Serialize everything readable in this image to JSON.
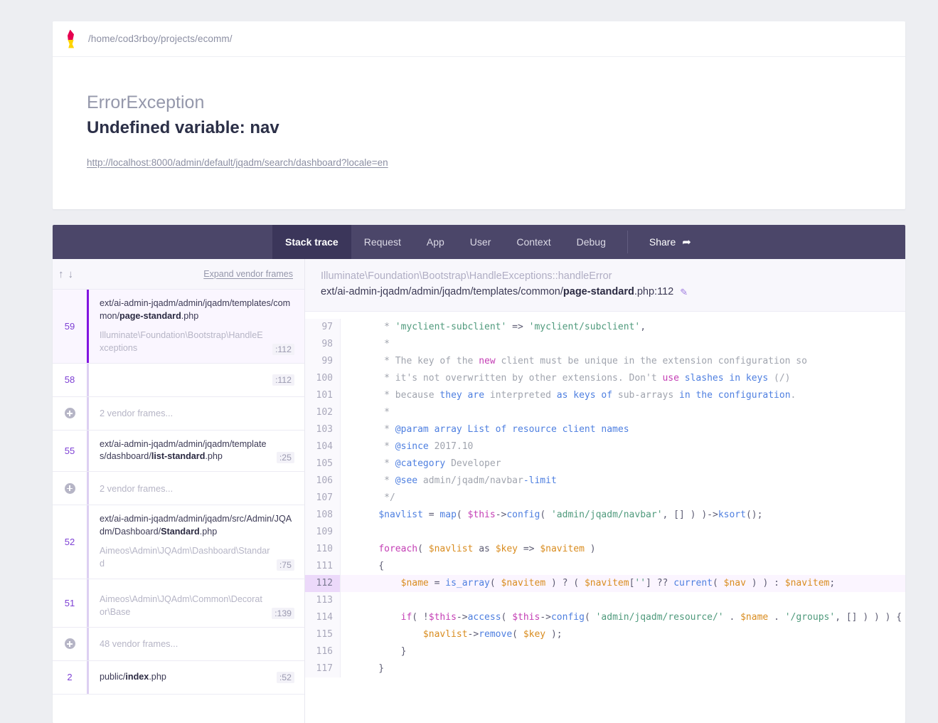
{
  "header": {
    "logo_icon": "ignition-flame-icon",
    "project_path": "/home/cod3rboy/projects/ecomm/",
    "exception_class": "ErrorException",
    "exception_message": "Undefined variable: nav",
    "request_url": "http://localhost:8000/admin/default/jqadm/search/dashboard?locale=en"
  },
  "tabs": [
    {
      "label": "Stack trace",
      "active": true
    },
    {
      "label": "Request",
      "active": false
    },
    {
      "label": "App",
      "active": false
    },
    {
      "label": "User",
      "active": false
    },
    {
      "label": "Context",
      "active": false
    },
    {
      "label": "Debug",
      "active": false
    }
  ],
  "share": {
    "label": "Share",
    "icon": "share-arrow-icon",
    "glyph": "➦"
  },
  "frames_panel": {
    "up_arrow": "↑",
    "down_arrow": "↓",
    "expand_label": "Expand vendor frames",
    "frames": [
      {
        "type": "frame",
        "number": "59",
        "path_prefix": "ext/ai-admin-jqadm/admin/jqadm/templates/common/",
        "path_file": "page-standard",
        "path_suffix": ".php",
        "class": "Illuminate\\Foundation\\Bootstrap\\HandleExceptions",
        "line": ":112",
        "active": true
      },
      {
        "type": "frame",
        "number": "58",
        "path_prefix": "",
        "path_file": "",
        "path_suffix": "",
        "class": "",
        "line": ":112",
        "active": false
      },
      {
        "type": "vendor",
        "label": "2 vendor frames...",
        "icon": "plus-circle-icon"
      },
      {
        "type": "frame",
        "number": "55",
        "path_prefix": "ext/ai-admin-jqadm/admin/jqadm/templates/dashboard/",
        "path_file": "list-standard",
        "path_suffix": ".php",
        "class": "",
        "line": ":25",
        "active": false
      },
      {
        "type": "vendor",
        "label": "2 vendor frames...",
        "icon": "plus-circle-icon"
      },
      {
        "type": "frame",
        "number": "52",
        "path_prefix": "ext/ai-admin-jqadm/admin/jqadm/src/Admin/JQAdm/Dashboard/",
        "path_file": "Standard",
        "path_suffix": ".php",
        "class": "Aimeos\\Admin\\JQAdm\\Dashboard\\Standard",
        "line": ":75",
        "active": false
      },
      {
        "type": "frame",
        "number": "51",
        "path_prefix": "",
        "path_file": "",
        "path_suffix": "",
        "class": "Aimeos\\Admin\\JQAdm\\Common\\Decorator\\Base",
        "line": ":139",
        "active": false
      },
      {
        "type": "vendor",
        "label": "48 vendor frames...",
        "icon": "plus-circle-icon"
      },
      {
        "type": "frame",
        "number": "2",
        "path_prefix": "public/",
        "path_file": "index",
        "path_suffix": ".php",
        "class": "",
        "line": ":52",
        "active": false
      }
    ]
  },
  "code_panel": {
    "class_name": "Illuminate\\Foundation\\Bootstrap\\HandleExceptions::handleError",
    "file_prefix": "ext/ai-admin-jqadm/admin/jqadm/templates/common/",
    "file_name": "page-standard",
    "file_suffix": ".php:112",
    "edit_icon": "pencil-icon",
    "edit_glyph": "✎",
    "highlighted_line": 112,
    "lines": [
      {
        "no": "97",
        "tokens": [
          {
            "t": "     * ",
            "c": "t-c"
          },
          {
            "t": "'myclient-subclient'",
            "c": "t-cg"
          },
          {
            "t": " => ",
            "c": "t-p"
          },
          {
            "t": "'myclient/subclient'",
            "c": "t-cg"
          },
          {
            "t": ",",
            "c": "t-p"
          }
        ]
      },
      {
        "no": "98",
        "tokens": [
          {
            "t": "     *",
            "c": "t-c"
          }
        ]
      },
      {
        "no": "99",
        "tokens": [
          {
            "t": "     * The key of the ",
            "c": "t-c"
          },
          {
            "t": "new",
            "c": "t-k"
          },
          {
            "t": " client must be unique in the extension configuration so",
            "c": "t-c"
          }
        ]
      },
      {
        "no": "100",
        "tokens": [
          {
            "t": "     * it's not overwritten by other extensions. Don't ",
            "c": "t-c"
          },
          {
            "t": "use",
            "c": "t-k"
          },
          {
            "t": " ",
            "c": "t-c"
          },
          {
            "t": "slashes in keys",
            "c": "t-cb"
          },
          {
            "t": " (/)",
            "c": "t-c"
          }
        ]
      },
      {
        "no": "101",
        "tokens": [
          {
            "t": "     * ",
            "c": "t-c"
          },
          {
            "t": "because",
            "c": "t-c"
          },
          {
            "t": " they are ",
            "c": "t-cb"
          },
          {
            "t": "interpreted",
            "c": "t-c"
          },
          {
            "t": " as keys of ",
            "c": "t-cb"
          },
          {
            "t": "sub-arrays",
            "c": "t-c"
          },
          {
            "t": " in the configuration",
            "c": "t-cb"
          },
          {
            "t": ".",
            "c": "t-c"
          }
        ]
      },
      {
        "no": "102",
        "tokens": [
          {
            "t": "     *",
            "c": "t-c"
          }
        ]
      },
      {
        "no": "103",
        "tokens": [
          {
            "t": "     * ",
            "c": "t-c"
          },
          {
            "t": "@param array List of resource client names",
            "c": "t-cb"
          }
        ]
      },
      {
        "no": "104",
        "tokens": [
          {
            "t": "     * ",
            "c": "t-c"
          },
          {
            "t": "@since",
            "c": "t-cb"
          },
          {
            "t": " 2017.10",
            "c": "t-c"
          }
        ]
      },
      {
        "no": "105",
        "tokens": [
          {
            "t": "     * ",
            "c": "t-c"
          },
          {
            "t": "@category",
            "c": "t-cb"
          },
          {
            "t": " Developer",
            "c": "t-c"
          }
        ]
      },
      {
        "no": "106",
        "tokens": [
          {
            "t": "     * ",
            "c": "t-c"
          },
          {
            "t": "@see",
            "c": "t-cb"
          },
          {
            "t": " admin/jqadm/navbar",
            "c": "t-c"
          },
          {
            "t": "-limit",
            "c": "t-cb"
          }
        ]
      },
      {
        "no": "107",
        "tokens": [
          {
            "t": "     */",
            "c": "t-c"
          }
        ]
      },
      {
        "no": "108",
        "tokens": [
          {
            "t": "    ",
            "c": "t-n"
          },
          {
            "t": "$navlist",
            "c": "t-f"
          },
          {
            "t": " = ",
            "c": "t-p"
          },
          {
            "t": "map",
            "c": "t-f"
          },
          {
            "t": "( ",
            "c": "t-p"
          },
          {
            "t": "$this",
            "c": "t-k"
          },
          {
            "t": "->",
            "c": "t-p"
          },
          {
            "t": "config",
            "c": "t-f"
          },
          {
            "t": "( ",
            "c": "t-p"
          },
          {
            "t": "'admin/jqadm/navbar'",
            "c": "t-cg"
          },
          {
            "t": ", [] ) )->",
            "c": "t-p"
          },
          {
            "t": "ksort",
            "c": "t-f"
          },
          {
            "t": "();",
            "c": "t-p"
          }
        ]
      },
      {
        "no": "109",
        "tokens": [
          {
            "t": "",
            "c": "t-n"
          }
        ]
      },
      {
        "no": "110",
        "tokens": [
          {
            "t": "    ",
            "c": "t-n"
          },
          {
            "t": "foreach",
            "c": "t-k"
          },
          {
            "t": "( ",
            "c": "t-p"
          },
          {
            "t": "$navlist",
            "c": "t-v"
          },
          {
            "t": " as ",
            "c": "t-p"
          },
          {
            "t": "$key",
            "c": "t-v"
          },
          {
            "t": " => ",
            "c": "t-p"
          },
          {
            "t": "$navitem",
            "c": "t-v"
          },
          {
            "t": " )",
            "c": "t-p"
          }
        ]
      },
      {
        "no": "111",
        "tokens": [
          {
            "t": "    {",
            "c": "t-p"
          }
        ]
      },
      {
        "no": "112",
        "tokens": [
          {
            "t": "        ",
            "c": "t-n"
          },
          {
            "t": "$name",
            "c": "t-v"
          },
          {
            "t": " = ",
            "c": "t-p"
          },
          {
            "t": "is_array",
            "c": "t-f"
          },
          {
            "t": "( ",
            "c": "t-p"
          },
          {
            "t": "$navitem",
            "c": "t-v"
          },
          {
            "t": " ) ? ( ",
            "c": "t-p"
          },
          {
            "t": "$navitem",
            "c": "t-v"
          },
          {
            "t": "[",
            "c": "t-p"
          },
          {
            "t": "''",
            "c": "t-cg"
          },
          {
            "t": "] ?? ",
            "c": "t-p"
          },
          {
            "t": "current",
            "c": "t-f"
          },
          {
            "t": "( ",
            "c": "t-p"
          },
          {
            "t": "$nav",
            "c": "t-v"
          },
          {
            "t": " ) ) : ",
            "c": "t-p"
          },
          {
            "t": "$navitem",
            "c": "t-v"
          },
          {
            "t": ";",
            "c": "t-p"
          }
        ]
      },
      {
        "no": "113",
        "tokens": [
          {
            "t": "",
            "c": "t-n"
          }
        ]
      },
      {
        "no": "114",
        "tokens": [
          {
            "t": "        ",
            "c": "t-n"
          },
          {
            "t": "if",
            "c": "t-k"
          },
          {
            "t": "( !",
            "c": "t-p"
          },
          {
            "t": "$this",
            "c": "t-k"
          },
          {
            "t": "->",
            "c": "t-p"
          },
          {
            "t": "access",
            "c": "t-f"
          },
          {
            "t": "( ",
            "c": "t-p"
          },
          {
            "t": "$this",
            "c": "t-k"
          },
          {
            "t": "->",
            "c": "t-p"
          },
          {
            "t": "config",
            "c": "t-f"
          },
          {
            "t": "( ",
            "c": "t-p"
          },
          {
            "t": "'admin/jqadm/resource/'",
            "c": "t-cg"
          },
          {
            "t": " . ",
            "c": "t-p"
          },
          {
            "t": "$name",
            "c": "t-v"
          },
          {
            "t": " . ",
            "c": "t-p"
          },
          {
            "t": "'/groups'",
            "c": "t-cg"
          },
          {
            "t": ", [] ) ) ) {",
            "c": "t-p"
          }
        ]
      },
      {
        "no": "115",
        "tokens": [
          {
            "t": "            ",
            "c": "t-n"
          },
          {
            "t": "$navlist",
            "c": "t-v"
          },
          {
            "t": "->",
            "c": "t-p"
          },
          {
            "t": "remove",
            "c": "t-f"
          },
          {
            "t": "( ",
            "c": "t-p"
          },
          {
            "t": "$key",
            "c": "t-v"
          },
          {
            "t": " );",
            "c": "t-p"
          }
        ]
      },
      {
        "no": "116",
        "tokens": [
          {
            "t": "        }",
            "c": "t-p"
          }
        ]
      },
      {
        "no": "117",
        "tokens": [
          {
            "t": "    }",
            "c": "t-p"
          }
        ]
      }
    ]
  },
  "colors": {
    "page_bg": "#edeef2",
    "tabbar_bg": "#4b4669",
    "tab_active_bg": "#3b365a",
    "accent_purple": "#8215e0",
    "highlight_gutter": "#ecd9fa",
    "highlight_row": "#fbf5ff"
  }
}
